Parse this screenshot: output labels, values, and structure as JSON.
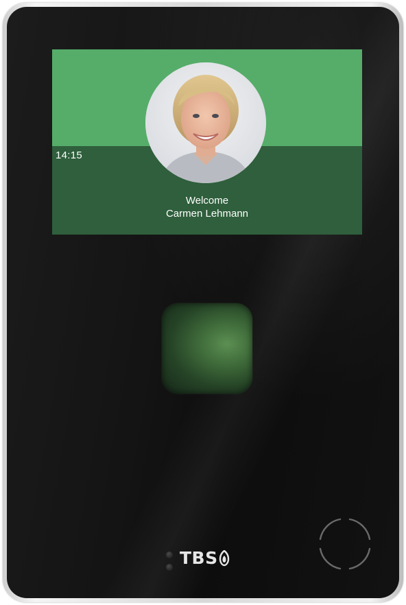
{
  "screen": {
    "clock": "14:15",
    "welcome_line": "Welcome",
    "user_name": "Carmen Lehmann"
  },
  "device": {
    "brand": "TBS"
  },
  "icons": {
    "reader": "nfc-reader-icon",
    "brand_mark": "tbs-logo-icon",
    "fingerprint": "fingerprint-sensor"
  },
  "colors": {
    "screen_top": "#55ad69",
    "screen_bottom": "#2f5f3c",
    "bezel": "#141414"
  }
}
